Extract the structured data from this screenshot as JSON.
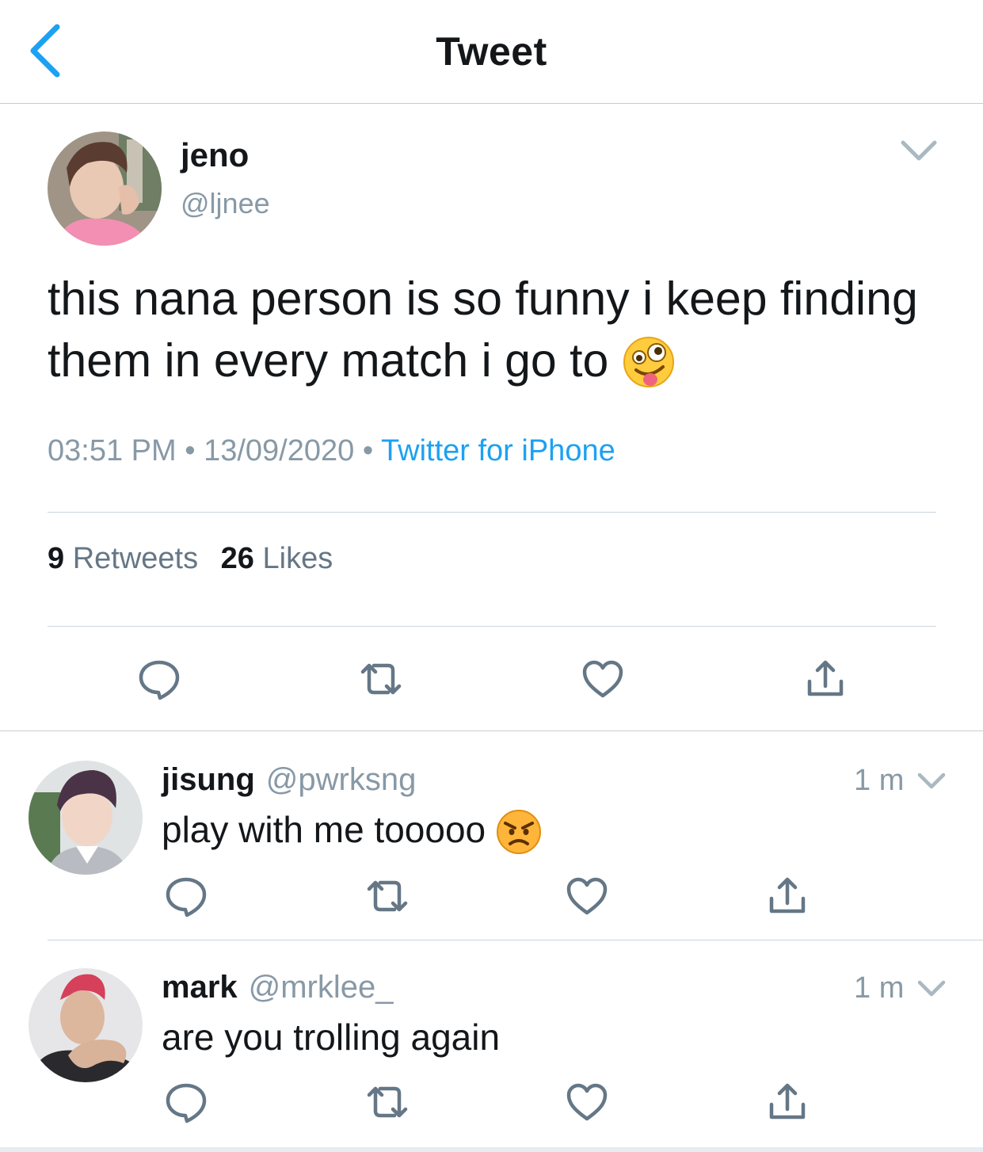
{
  "header": {
    "title": "Tweet",
    "back_icon": "chevron-left-icon"
  },
  "main_tweet": {
    "display_name": "jeno",
    "handle": "@ljnee",
    "text": "this nana person is so funny i keep finding them in every match i go to",
    "emoji": "zany-face",
    "time": "03:51 PM",
    "date": "13/09/2020",
    "dot": "•",
    "source": "Twitter for iPhone",
    "retweets_count": "9",
    "retweets_label": "Retweets",
    "likes_count": "26",
    "likes_label": "Likes"
  },
  "replies": [
    {
      "display_name": "jisung",
      "handle": "@pwrksng",
      "time": "1 m",
      "text": "play with me tooooo",
      "emoji": "angry-face"
    },
    {
      "display_name": "mark",
      "handle": "@mrklee_",
      "time": "1 m",
      "text": "are you trolling again"
    }
  ],
  "colors": {
    "accent": "#1da1f2",
    "text": "#14171a",
    "muted": "#8899a6",
    "icon": "#657786",
    "divider": "#ccd6dd"
  }
}
